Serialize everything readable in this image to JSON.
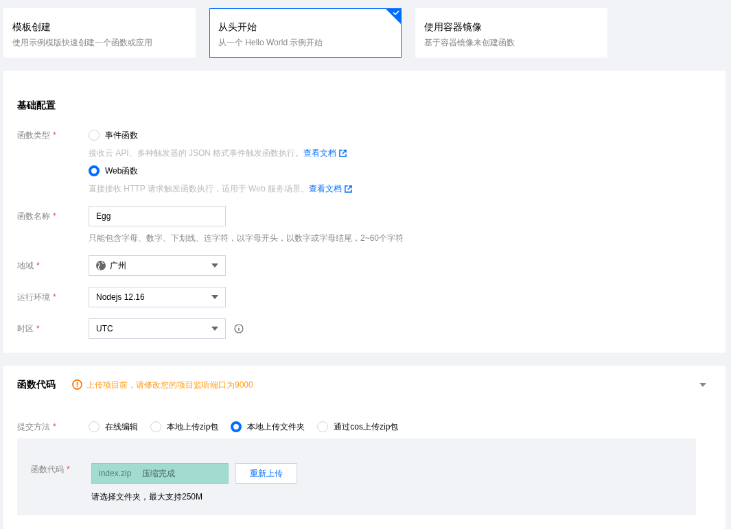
{
  "create_modes": [
    {
      "title": "模板创建",
      "description": "使用示例模版快速创建一个函数或应用",
      "selected": false
    },
    {
      "title": "从头开始",
      "description": "从一个 Hello World 示例开始",
      "selected": true
    },
    {
      "title": "使用容器镜像",
      "description": "基于容器镜像来创建函数",
      "selected": false
    }
  ],
  "basic_config": {
    "title": "基础配置",
    "function_type": {
      "label": "函数类型",
      "required_mark": "*",
      "options": [
        {
          "label": "事件函数",
          "selected": false,
          "description": "接收云 API、多种触发器的 JSON 格式事件触发函数执行。",
          "link": "查看文档"
        },
        {
          "label": "Web函数",
          "selected": true,
          "description": "直接接收 HTTP 请求触发函数执行，适用于 Web 服务场景。",
          "link": "查看文档"
        }
      ]
    },
    "function_name": {
      "label": "函数名称",
      "required_mark": "*",
      "value": "Egg",
      "hint": "只能包含字母、数字、下划线、连字符，以字母开头，以数字或字母结尾，2~60个字符"
    },
    "selects": [
      {
        "label": "地域",
        "required_mark": "*",
        "value": "广州",
        "kind": "region"
      },
      {
        "label": "运行环境",
        "required_mark": "*",
        "value": "Nodejs 12.16",
        "kind": "plain"
      },
      {
        "label": "时区",
        "required_mark": "*",
        "value": "UTC",
        "kind": "info"
      }
    ]
  },
  "function_code": {
    "title": "函数代码",
    "warning": "上传项目前，请修改您的项目监听端口为9000",
    "expanded": true,
    "submit_method": {
      "label": "提交方法",
      "required_mark": "*",
      "options": [
        {
          "label": "在线编辑",
          "selected": false
        },
        {
          "label": "本地上传zip包",
          "selected": false
        },
        {
          "label": "本地上传文件夹",
          "selected": true
        },
        {
          "label": "通过cos上传zip包",
          "selected": false
        }
      ]
    },
    "upload": {
      "label": "函数代码",
      "required_mark": "*",
      "file_name": "index.zip",
      "status": "压缩完成",
      "level": 1,
      "button": "重新上传",
      "hint": "请选择文件夹，最大支持250M"
    }
  }
}
